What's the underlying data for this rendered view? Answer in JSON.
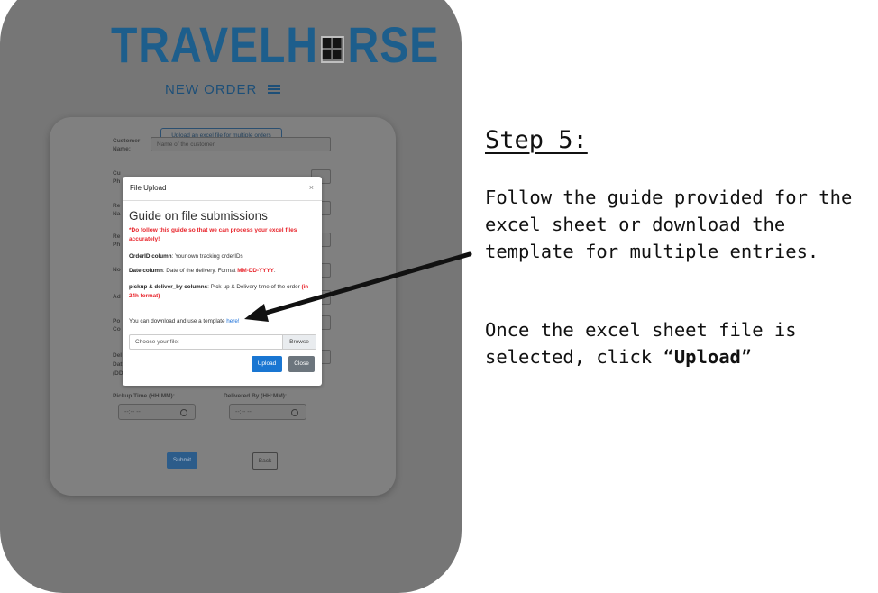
{
  "app": {
    "logo_left": "TRAVELH",
    "logo_right": "RSE",
    "page_title": "NEW ORDER"
  },
  "form": {
    "upload_multiple_label": "Upload an excel file for multiple orders",
    "customer_name_label": "Customer Name:",
    "customer_name_placeholder": "Name of the customer",
    "label_fragments": [
      "Cu",
      "Ph",
      "Re",
      "Na",
      "Re",
      "Ph",
      "No",
      "Ad",
      "Po",
      "Co"
    ],
    "delivery_date_label": "Del",
    "delivery_date_label2": "Dat",
    "delivery_date_format": "(DD/MM/YYYY):",
    "pickup_time_label": "Pickup Time (HH:MM):",
    "delivered_by_label": "Delivered By (HH:MM):",
    "time_placeholder": "--:-- --",
    "submit_label": "Submit",
    "back_label": "Back"
  },
  "modal": {
    "title": "File Upload",
    "close_symbol": "×",
    "heading": "Guide on file submissions",
    "warning": "*Do follow this guide so that we can process your excel files accurately!",
    "orderid_term": "OrderID column",
    "orderid_desc": ": Your own tracking orderIDs",
    "date_term": "Date column",
    "date_desc": ": Date of the delivery. Format ",
    "date_format": "MM-DD-YYYY",
    "date_end": ".",
    "pickup_term": "pickup & deliver_by columns",
    "pickup_desc": ": Pick-up & Delivery time of the order ",
    "pickup_note": "(in 24h format)",
    "template_text": "You can download and use a template ",
    "template_link": "here!",
    "file_placeholder": "Choose your file:",
    "browse_label": "Browse",
    "upload_label": "Upload",
    "close_label": "Close"
  },
  "instructions": {
    "step_title": "Step 5:",
    "paragraph1": "Follow the guide provided for the excel sheet or download the template for multiple entries.",
    "paragraph2_start": "Once the excel sheet file is selected, click ",
    "paragraph2_open_quote": "“",
    "paragraph2_bold": "Upload",
    "paragraph2_close_quote": "”"
  },
  "colors": {
    "brand_blue": "#1d5e8c",
    "primary_button": "#1976d2",
    "secondary_button": "#6c757d",
    "warning_red": "#e8232a",
    "overlay_gray": "#767676"
  }
}
